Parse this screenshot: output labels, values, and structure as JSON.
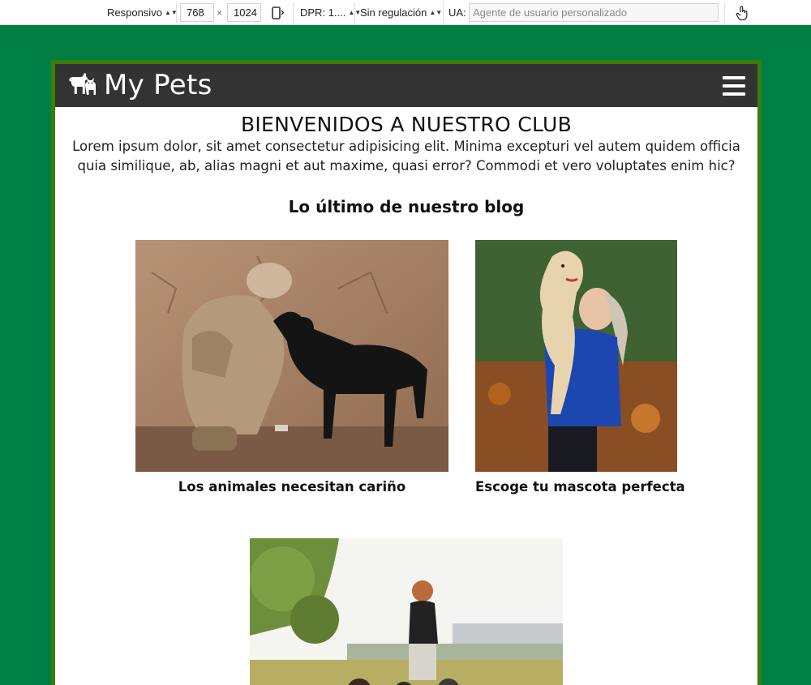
{
  "devtools": {
    "device_mode": "Responsivo",
    "width": "768",
    "times": "×",
    "height": "1024",
    "dpr_label": "DPR: 1....",
    "throttling": "Sin regulación",
    "ua_label": "UA:",
    "ua_placeholder": "Agente de usuario personalizado",
    "rotate_icon": "rotate-device-icon",
    "touch_icon": "touch-hand-icon"
  },
  "site": {
    "brand": "My Pets",
    "brand_icon": "dog-and-cat-icon",
    "menu_icon": "hamburger-menu-icon",
    "welcome_title": "BIENVENIDOS A NUESTRO CLUB",
    "intro": "Lorem ipsum dolor, sit amet consectetur adipisicing elit. Minima excepturi vel autem quidem officia quia similique, ab, alias magni et aut maxime, quasi error? Commodi et vero voluptates enim hic?",
    "blog_title": "Lo último de nuestro blog",
    "posts": [
      {
        "caption": "Los animales necesitan cariño",
        "image": "soldier-hugging-black-dog"
      },
      {
        "caption": "Escoge tu mascota perfecta",
        "image": "woman-holding-labrador-autumn"
      },
      {
        "caption": "",
        "image": "woman-walking-dogs-park"
      }
    ]
  },
  "colors": {
    "page_background": "#007f44",
    "frame_border": "#3b7d0a",
    "navbar": "#333333"
  }
}
